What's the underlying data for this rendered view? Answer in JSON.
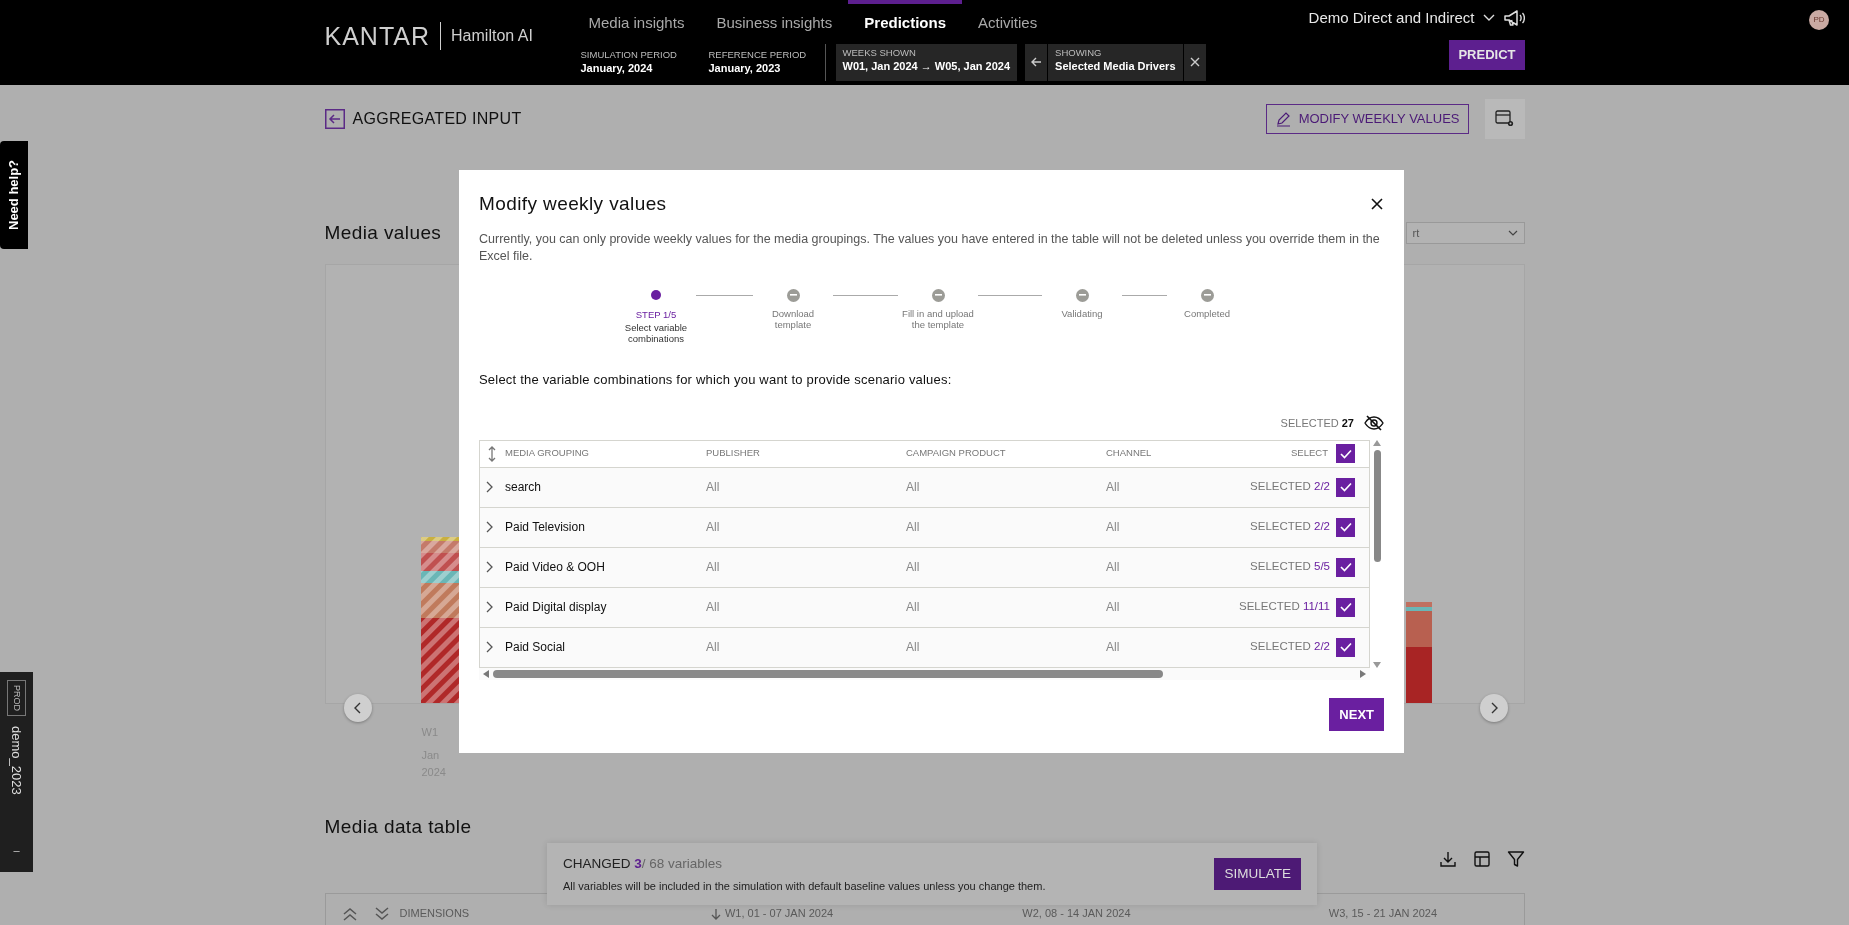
{
  "header": {
    "logo": "KANTAR",
    "product": "Hamilton AI",
    "nav": [
      {
        "label": "Media insights",
        "selected": false
      },
      {
        "label": "Business insights",
        "selected": false
      },
      {
        "label": "Predictions",
        "selected": true
      },
      {
        "label": "Activities",
        "selected": false
      }
    ],
    "periods": [
      {
        "label": "SIMULATION PERIOD",
        "value": "January, 2024"
      },
      {
        "label": "REFERENCE PERIOD",
        "value": "January, 2023"
      }
    ],
    "weeks_shown": {
      "label": "WEEKS SHOWN",
      "value": "W01, Jan 2024 → W05, Jan 2024"
    },
    "showing": {
      "label": "SHOWING",
      "value": "Selected Media Drivers"
    },
    "account": "Demo Direct and Indirect",
    "predict": "PREDICT",
    "avatar": "PD"
  },
  "side": {
    "help": "Need help?",
    "env": "PROD",
    "workspace": "demo_2023",
    "collapse": "–"
  },
  "page": {
    "back_title": "AGGREGATED INPUT",
    "modify_button": "MODIFY WEEKLY VALUES",
    "section_title": "Media values",
    "dropdown": "rt",
    "chart_labels": [
      "W1",
      "Jan",
      "2024"
    ],
    "table_title": "Media data table",
    "table_columns": [
      "DIMENSIONS",
      "W1, 01 - 07 JAN 2024",
      "W2, 08 - 14 JAN 2024",
      "W3, 15 - 21 JAN 2024"
    ]
  },
  "banner": {
    "label": "CHANGED",
    "changed": "3",
    "total": "/ 68 variables",
    "note": "All variables will be included in the simulation with default baseline values unless you change them.",
    "button": "SIMULATE"
  },
  "modal": {
    "title": "Modify weekly values",
    "description": "Currently, you can only provide weekly values for the media groupings. The values you have entered in the table will not be deleted unless you override them in the Excel file.",
    "steps": [
      {
        "label": "STEP 1/5",
        "caption": "Select variable combinations",
        "selected": true
      },
      {
        "label": "Download template",
        "selected": false
      },
      {
        "label": "Fill in and upload the template",
        "selected": false
      },
      {
        "label": "Validating",
        "selected": false
      },
      {
        "label": "Completed",
        "selected": false
      }
    ],
    "prompt": "Select the variable combinations for which you want to provide scenario values:",
    "selected_label": "SELECTED",
    "selected_total": "27",
    "columns": [
      "MEDIA GROUPING",
      "PUBLISHER",
      "CAMPAIGN PRODUCT",
      "CHANNEL",
      "SELECT"
    ],
    "select_all_checked": true,
    "rows": [
      {
        "name": "search",
        "publisher": "All",
        "campaign_product": "All",
        "channel": "All",
        "selected_label": "SELECTED",
        "count": "2/2",
        "checked": true,
        "expanded": false
      },
      {
        "name": "Paid Television",
        "publisher": "All",
        "campaign_product": "All",
        "channel": "All",
        "selected_label": "SELECTED",
        "count": "2/2",
        "checked": true,
        "expanded": false
      },
      {
        "name": "Paid Video & OOH",
        "publisher": "All",
        "campaign_product": "All",
        "channel": "All",
        "selected_label": "SELECTED",
        "count": "5/5",
        "checked": true,
        "expanded": false
      },
      {
        "name": "Paid Digital display",
        "publisher": "All",
        "campaign_product": "All",
        "channel": "All",
        "selected_label": "SELECTED",
        "count": "11/11",
        "checked": true,
        "expanded": false
      },
      {
        "name": "Paid Social",
        "publisher": "All",
        "campaign_product": "All",
        "channel": "All",
        "selected_label": "SELECTED",
        "count": "2/2",
        "checked": true,
        "expanded": false
      }
    ],
    "next": "NEXT"
  }
}
